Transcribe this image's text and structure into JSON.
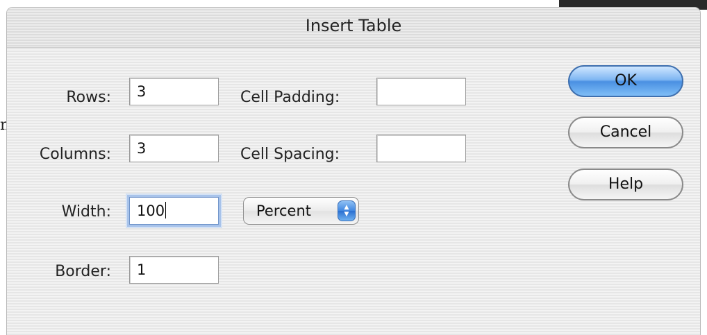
{
  "dialog": {
    "title": "Insert Table"
  },
  "form": {
    "rows_label": "Rows:",
    "rows_value": "3",
    "columns_label": "Columns:",
    "columns_value": "3",
    "width_label": "Width:",
    "width_value": "100",
    "border_label": "Border:",
    "border_value": "1",
    "cell_padding_label": "Cell Padding:",
    "cell_padding_value": "",
    "cell_spacing_label": "Cell Spacing:",
    "cell_spacing_value": "",
    "width_unit": "Percent"
  },
  "buttons": {
    "ok": "OK",
    "cancel": "Cancel",
    "help": "Help"
  },
  "background": {
    "partial_text": "n"
  }
}
